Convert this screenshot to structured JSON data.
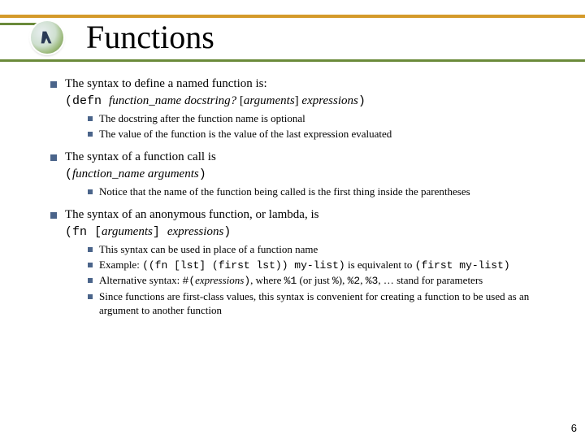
{
  "title": "Functions",
  "page_number": "6",
  "b1": {
    "intro": "The syntax to define a named function is:",
    "syn": {
      "open": "(",
      "defn": "defn",
      "sp1": "   ",
      "fname": "function_name",
      "sp2": "   ",
      "docq": "docstring?",
      "sp3": "    [",
      "args": "arguments",
      "sp4": "]    ",
      "exprs": "expressions",
      "close": ")"
    },
    "sub1": "The docstring after the function name is optional",
    "sub2": "The value of the function is the value of the last expression evaluated"
  },
  "b2": {
    "intro": "The syntax of a function call is",
    "syn": {
      "open": "(",
      "fname": "function_name",
      "sp": "    ",
      "args": "arguments",
      "close": ")"
    },
    "sub1": "Notice that the name of the function being called is the first thing inside the parentheses"
  },
  "b3": {
    "intro_a": "The syntax of an anonymous function, or ",
    "intro_b": "lambda",
    "intro_c": ", is",
    "syn": {
      "open": "(",
      "fn": "fn",
      "sp1": "   [",
      "args": "arguments",
      "sp2": "]    ",
      "exprs": "expressions",
      "close": ")"
    },
    "s1": "This syntax can be used in place of a function name",
    "s2a": "Example: ",
    "s2b": "((fn [lst] (first lst)) my-list)",
    "s2c": " is equivalent to ",
    "s2d": "(first my-list)",
    "s3a": "Alternative syntax: ",
    "s3b": "#(",
    "s3c": "expressions",
    "s3d": ")",
    "s3e": ", where ",
    "s3f": "%1",
    "s3g": " (or just ",
    "s3h": "%",
    "s3i": "), ",
    "s3j": "%2",
    "s3k": ", ",
    "s3l": "%3",
    "s3m": ", … stand for parameters",
    "s4": "Since functions are first-class values, this syntax is convenient for creating a function to be used as an argument to another function"
  }
}
